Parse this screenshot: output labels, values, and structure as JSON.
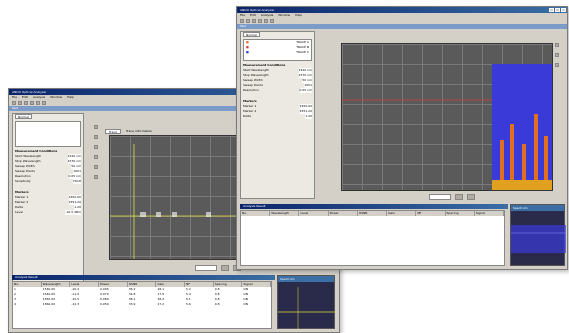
{
  "back_window": {
    "title": "ANDO Optical Analyzer",
    "menu": [
      "File",
      "Edit",
      "Analysis",
      "Window",
      "Help"
    ],
    "subtitle": "Test",
    "mode_select": "Normal",
    "trace_tabs": [
      "Trace",
      "Trace information"
    ],
    "settings_header": "Measurement Conditions",
    "settings": [
      {
        "label": "Start Wavelength",
        "value": "1520 nm"
      },
      {
        "label": "Stop Wavelength",
        "value": "1570 nm"
      },
      {
        "label": "Sweep Width",
        "value": "50 nm"
      },
      {
        "label": "Sweep Points",
        "value": "1001"
      },
      {
        "label": "Resolution",
        "value": "0.05 nm"
      },
      {
        "label": "Sensitivity",
        "value": "HIGH"
      }
    ],
    "markers_header": "Markers",
    "markers": [
      {
        "label": "Marker 1",
        "value": "1550.00"
      },
      {
        "label": "Marker 2",
        "value": "1551.20"
      },
      {
        "label": "Delta",
        "value": "1.20"
      },
      {
        "label": "Level",
        "value": "-10.5 dBm"
      }
    ],
    "table_title": "Analysis Result",
    "table_headers": [
      "No.",
      "Wavelength",
      "Level",
      "Power",
      "OSNR",
      "Gain",
      "NF",
      "Spacing",
      "Signal"
    ],
    "table_rows": [
      [
        "1",
        "1530.00",
        "-10.2",
        "0.095",
        "35.2",
        "18.1",
        "5.2",
        "0.8",
        "ON"
      ],
      [
        "2",
        "1540.00",
        "-11.0",
        "0.079",
        "34.8",
        "17.9",
        "5.4",
        "0.8",
        "ON"
      ],
      [
        "3",
        "1550.00",
        "-10.5",
        "0.089",
        "36.1",
        "18.4",
        "5.1",
        "0.8",
        "ON"
      ],
      [
        "4",
        "1560.00",
        "-12.3",
        "0.059",
        "33.9",
        "17.2",
        "5.6",
        "0.8",
        "ON"
      ]
    ],
    "mini_title": "Spectrum"
  },
  "front_window": {
    "title": "ANDO Optical Analyzer",
    "menu": [
      "File",
      "Edit",
      "Analysis",
      "Window",
      "Help"
    ],
    "subtitle": "Test",
    "mode_select": "Normal",
    "trace_legend": [
      "TRACE A",
      "TRACE B",
      "TRACE C"
    ],
    "settings_header": "Measurement Conditions",
    "settings": [
      {
        "label": "Start Wavelength",
        "value": "1520 nm"
      },
      {
        "label": "Stop Wavelength",
        "value": "1570 nm"
      },
      {
        "label": "Sweep Width",
        "value": "50 nm"
      },
      {
        "label": "Sweep Points",
        "value": "1001"
      },
      {
        "label": "Resolution",
        "value": "0.05 nm"
      }
    ],
    "markers_header": "Markers",
    "markers": [
      {
        "label": "Marker 1",
        "value": "1550.00"
      },
      {
        "label": "Marker 2",
        "value": "1551.20"
      },
      {
        "label": "Delta",
        "value": "1.20"
      }
    ],
    "table_title": "Analysis Result",
    "table_headers": [
      "No.",
      "Wavelength",
      "Level",
      "Power",
      "OSNR",
      "Gain",
      "NF",
      "Spacing",
      "Signal"
    ],
    "mini_title": "Spectrum"
  },
  "colors": {
    "title_bar": "#0a246a",
    "plot_bg": "#5a5a5a",
    "trace_red": "#d83a3a",
    "trace_blue": "#3a3ad8",
    "trace_orange": "#e07020",
    "trace_yellow": "#e0e040"
  }
}
